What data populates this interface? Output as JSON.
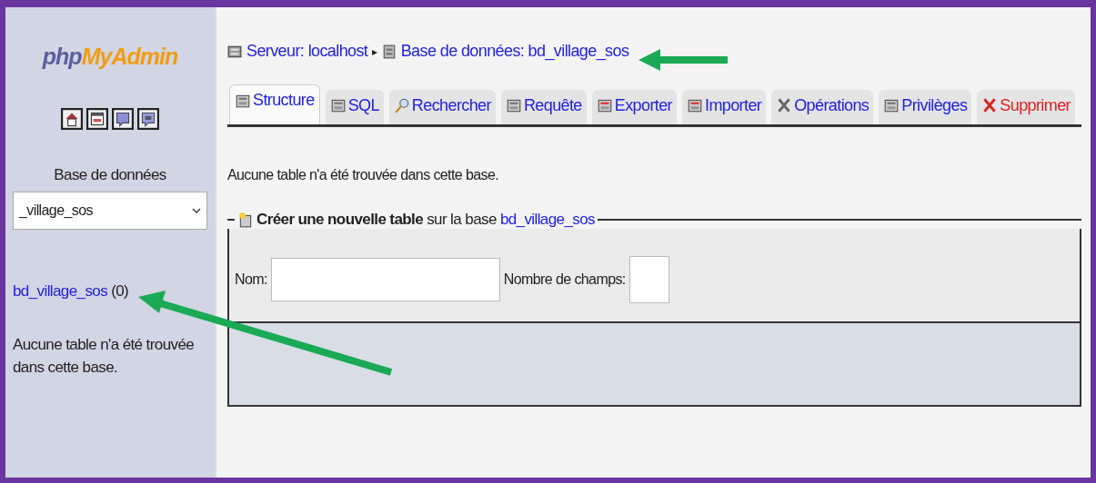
{
  "sidebar": {
    "logo": {
      "php": "php",
      "myadmin": "MyAdmin"
    },
    "database_label": "Base de données",
    "database_select": {
      "value": "_village_sos"
    },
    "database_link": {
      "name": "bd_village_sos",
      "count": "(0)"
    },
    "message": "Aucune table n'a été trouvée dans cette base."
  },
  "breadcrumb": {
    "server": "Serveur: localhost",
    "separator": "▸",
    "database": "Base de données: bd_village_sos"
  },
  "tabs": [
    {
      "label": "Structure",
      "selected": true,
      "kind": "normal"
    },
    {
      "label": "SQL",
      "selected": false,
      "kind": "normal"
    },
    {
      "label": "Rechercher",
      "selected": false,
      "kind": "normal"
    },
    {
      "label": "Requête",
      "selected": false,
      "kind": "normal"
    },
    {
      "label": "Exporter",
      "selected": false,
      "kind": "normal"
    },
    {
      "label": "Importer",
      "selected": false,
      "kind": "normal"
    },
    {
      "label": "Opérations",
      "selected": false,
      "kind": "normal"
    },
    {
      "label": "Privilèges",
      "selected": false,
      "kind": "normal"
    },
    {
      "label": "Supprimer",
      "selected": false,
      "kind": "danger"
    }
  ],
  "message": "Aucune table n'a été trouvée dans cette base.",
  "create_table": {
    "legend": "Créer une nouvelle table",
    "legend_middle": "sur la base",
    "legend_db": "bd_village_sos",
    "name_label": "Nom:",
    "fields_label": "Nombre de champs:"
  }
}
